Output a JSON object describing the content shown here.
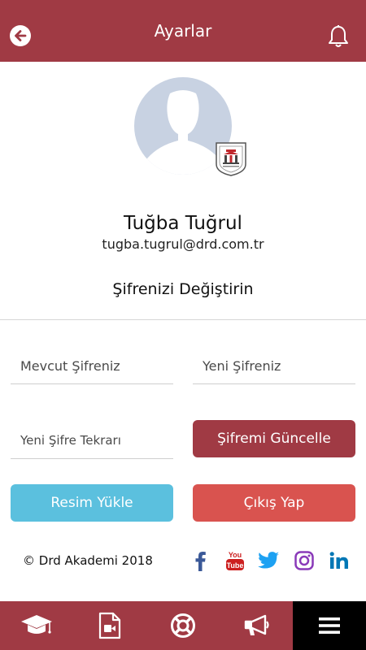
{
  "header": {
    "title": "Ayarlar"
  },
  "profile": {
    "name": "Tuğba Tuğrul",
    "email": "tugba.tugrul@drd.com.tr"
  },
  "password_section": {
    "title": "Şifrenizi Değiştirin",
    "current_placeholder": "Mevcut Şifreniz",
    "new_placeholder": "Yeni Şifreniz",
    "repeat_placeholder": "Yeni Şifre Tekrarı",
    "update_button": "Şifremi Güncelle"
  },
  "actions": {
    "upload_button": "Resim Yükle",
    "logout_button": "Çıkış Yap"
  },
  "footer": {
    "copyright": "© Drd Akademi 2018",
    "youtube_label": "You Tube"
  },
  "colors": {
    "primary": "#a03a44",
    "upload": "#5bc0de",
    "logout": "#d9534f",
    "facebook": "#3b5998",
    "youtube": "#cc1f1f",
    "twitter": "#1da1f2",
    "instagram": "#8a3ab9",
    "linkedin": "#0077b5"
  },
  "icons": {
    "header": [
      "back-arrow-icon",
      "bell-icon"
    ],
    "social": [
      "facebook-icon",
      "youtube-icon",
      "twitter-icon",
      "instagram-icon",
      "linkedin-icon"
    ],
    "tabs": [
      "graduation-cap-icon",
      "video-file-icon",
      "lifebuoy-icon",
      "megaphone-icon",
      "menu-icon"
    ]
  },
  "active_tab": "menu"
}
